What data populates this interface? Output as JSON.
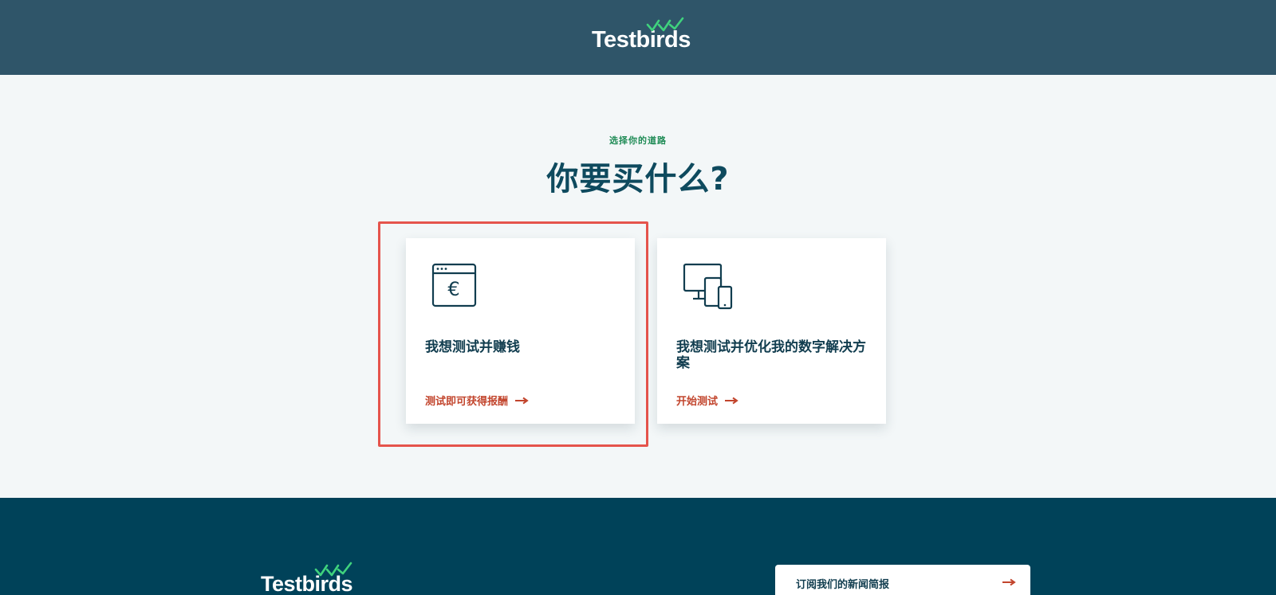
{
  "brand": {
    "name": "Testbirds",
    "logo_icon": "checkmarks-icon",
    "accent_check_color": "#3fd27d",
    "header_bg": "#2f5569",
    "footer_bg": "#004259"
  },
  "main": {
    "eyebrow": "选择你的道路",
    "headline": "你要买什么?",
    "cards": [
      {
        "icon": "browser-euro-icon",
        "title": "我想测试并赚钱",
        "cta": "测试即可获得报酬",
        "highlighted": true
      },
      {
        "icon": "devices-icon",
        "title": "我想测试并优化我的数字解决方案",
        "cta": "开始测试"
      }
    ]
  },
  "footer": {
    "newsletter_label": "订阅我们的新闻简报",
    "newsletter_icon": "arrow-right-icon"
  }
}
